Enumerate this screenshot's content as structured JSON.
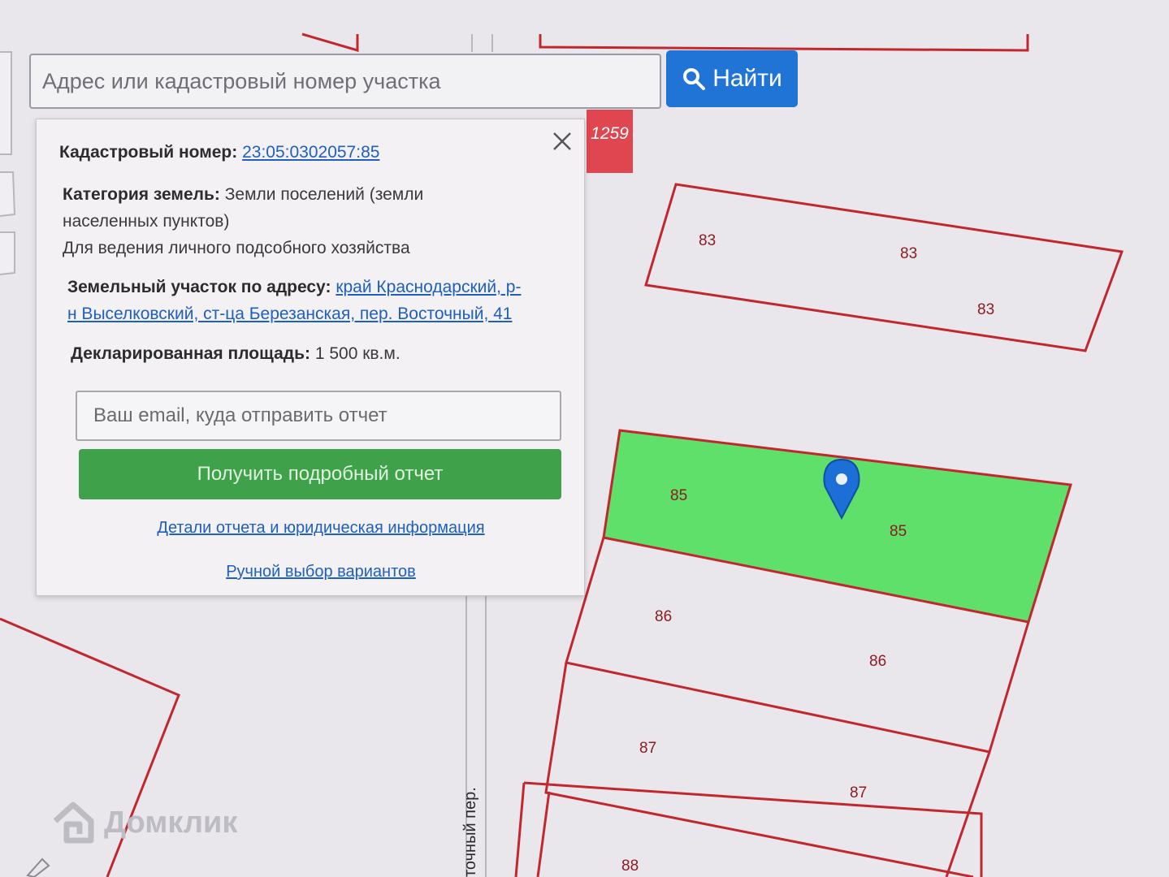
{
  "search": {
    "placeholder": "Адрес или кадастровый номер участка",
    "button_label": "Найти"
  },
  "panel": {
    "cadastral_label": "Кадастровый номер:",
    "cadastral_value": "23:05:0302057:85",
    "category_label": "Категория земель:",
    "category_value_line1": "Земли поселений (земли",
    "category_value_line2": "населенных пунктов)",
    "usage": "Для ведения личного подсобного хозяйства",
    "address_label": "Земельный участок по адресу:",
    "address_line1": "край Краснодарский, р-",
    "address_line2": "н Выселковский, ст-ца Березанская, пер. Восточный, 41",
    "area_label": "Декларированная площадь:",
    "area_value": "1 500 кв.м.",
    "email_placeholder": "Ваш email, куда отправить отчет",
    "report_button": "Получить подробный отчет",
    "details_link": "Детали отчета и юридическая информация",
    "manual_link": "Ручной выбор вариантов"
  },
  "map": {
    "badge": "1259",
    "street_label": "точный пер.",
    "highlight_color": "#5fe06a",
    "boundary_color": "#c0282e",
    "marker_color": "#1b6fd6",
    "parcel_labels": {
      "p83a": "83",
      "p83b": "83",
      "p83c": "83",
      "p85a": "85",
      "p85b": "85",
      "p86a": "86",
      "p86b": "86",
      "p87a": "87",
      "p87b": "87",
      "p88": "88"
    }
  },
  "watermark": "Домклик"
}
